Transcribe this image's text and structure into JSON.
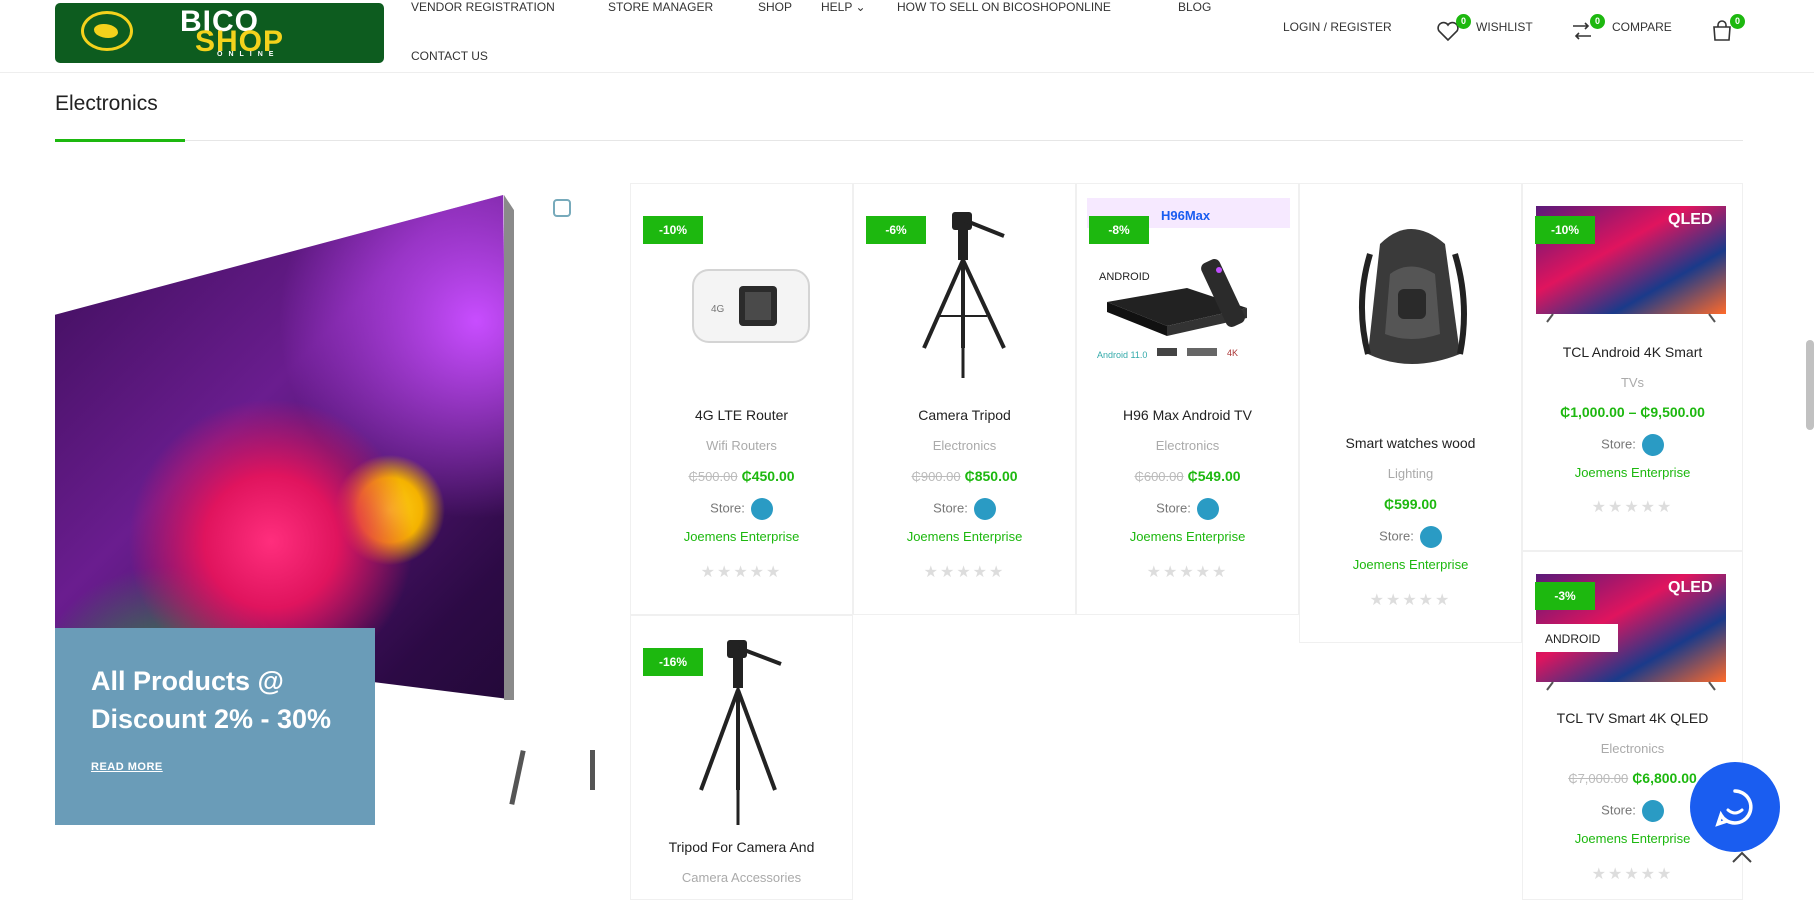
{
  "logo": {
    "line1": "BICO",
    "line2": "SHOP",
    "line3": "ONLINE"
  },
  "nav": {
    "items": [
      "VENDOR REGISTRATION",
      "STORE MANAGER",
      "SHOP",
      "HELP",
      "HOW TO SELL ON BICOSHOPONLINE",
      "BLOG",
      "CONTACT US"
    ]
  },
  "header_right": {
    "login": "LOGIN / REGISTER",
    "wishlist": "WISHLIST",
    "wishlist_count": "0",
    "compare": "COMPARE",
    "compare_count": "0",
    "cart_count": "0"
  },
  "section": {
    "title": "Electronics"
  },
  "banner": {
    "heading": "All Products @ Discount 2% - 30%",
    "link": "READ MORE"
  },
  "store_label": "Store:",
  "products": [
    {
      "badge": "-10%",
      "title": "4G LTE Router",
      "category": "Wifi Routers",
      "old_price": "₵500.00",
      "price": "₵450.00",
      "vendor": "Joemens Enterprise"
    },
    {
      "badge": "-6%",
      "title": "Camera Tripod",
      "category": "Electronics",
      "old_price": "₵900.00",
      "price": "₵850.00",
      "vendor": "Joemens Enterprise"
    },
    {
      "badge": "-8%",
      "title": "H96 Max Android TV",
      "category": "Electronics",
      "old_price": "₵600.00",
      "price": "₵549.00",
      "vendor": "Joemens Enterprise",
      "overlay": "ANDROID"
    },
    {
      "badge": "",
      "title": "Smart watches wood",
      "category": "Lighting",
      "old_price": "",
      "price": "₵599.00",
      "vendor": "Joemens Enterprise"
    },
    {
      "badge": "-10%",
      "title": "TCL Android 4K Smart",
      "category": "TVs",
      "old_price": "",
      "price": "₵1,000.00 – ₵9,500.00",
      "vendor": "Joemens Enterprise",
      "overlay": "QLED"
    },
    {
      "badge": "-16%",
      "title": "Tripod For Camera And",
      "category": "Camera Accessories",
      "old_price": "",
      "price": "",
      "vendor": ""
    },
    {
      "badge": "-3%",
      "title": "TCL TV Smart 4K QLED",
      "category": "Electronics",
      "old_price": "₵7,000.00",
      "price": "₵6,800.00",
      "vendor": "Joemens Enterprise",
      "overlay": "QLED",
      "overlay2": "ANDROID"
    }
  ],
  "stars": "★★★★★",
  "colors": {
    "brand_green": "#1db80f",
    "logo_green": "#0d5c1f",
    "banner_box": "#6a9cb8",
    "chat_blue": "#1a5df0"
  }
}
